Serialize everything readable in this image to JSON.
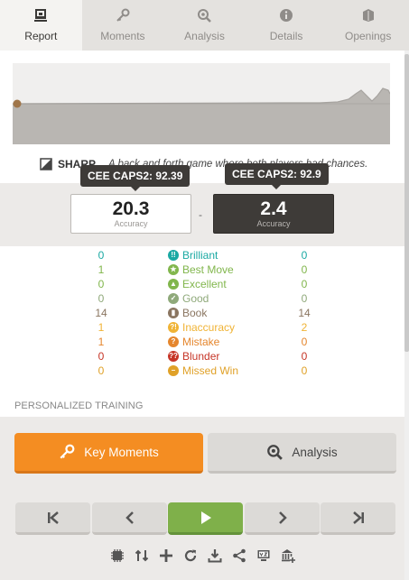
{
  "tabs": [
    {
      "label": "Report",
      "icon": "report-icon",
      "active": true
    },
    {
      "label": "Moments",
      "icon": "key-icon",
      "active": false
    },
    {
      "label": "Analysis",
      "icon": "magnifier-icon",
      "active": false
    },
    {
      "label": "Details",
      "icon": "info-icon",
      "active": false
    },
    {
      "label": "Openings",
      "icon": "book-icon",
      "active": false
    }
  ],
  "summary": {
    "label": "SHARP",
    "description": "A back and forth game where both players had chances."
  },
  "tooltips": {
    "white": "CEE CAPS2: 92.39",
    "black": "CEE CAPS2: 92.9"
  },
  "accuracy": {
    "white_value": "20.3",
    "black_value": "2.4",
    "label": "Accuracy",
    "separator": "-"
  },
  "stats": [
    {
      "label": "Brilliant",
      "white": "0",
      "black": "0",
      "color": "#1ba9a3",
      "icon": "brilliant-icon",
      "glyph": "!!"
    },
    {
      "label": "Best Move",
      "white": "1",
      "black": "0",
      "color": "#81b64c",
      "icon": "star-icon",
      "glyph": "★"
    },
    {
      "label": "Excellent",
      "white": "0",
      "black": "0",
      "color": "#81b64c",
      "icon": "thumbs-up-icon",
      "glyph": "👍"
    },
    {
      "label": "Good",
      "white": "0",
      "black": "0",
      "color": "#8fa97a",
      "icon": "check-icon",
      "glyph": "✓"
    },
    {
      "label": "Book",
      "white": "14",
      "black": "14",
      "color": "#8a7560",
      "icon": "book-icon",
      "glyph": "▮"
    },
    {
      "label": "Inaccuracy",
      "white": "1",
      "black": "2",
      "color": "#f0b335",
      "icon": "inaccuracy-icon",
      "glyph": "?!"
    },
    {
      "label": "Mistake",
      "white": "1",
      "black": "0",
      "color": "#e5862d",
      "icon": "mistake-icon",
      "glyph": "?"
    },
    {
      "label": "Blunder",
      "white": "0",
      "black": "0",
      "color": "#c63527",
      "icon": "blunder-icon",
      "glyph": "??"
    },
    {
      "label": "Missed Win",
      "white": "0",
      "black": "0",
      "color": "#e0a128",
      "icon": "missed-win-icon",
      "glyph": "–"
    }
  ],
  "section_label": "PERSONALIZED TRAINING",
  "buttons": {
    "key_moments": "Key Moments",
    "analysis": "Analysis"
  },
  "colors": {
    "accent_orange": "#f48d22",
    "play_green": "#7fb04a",
    "dark_box": "#3e3b38"
  }
}
